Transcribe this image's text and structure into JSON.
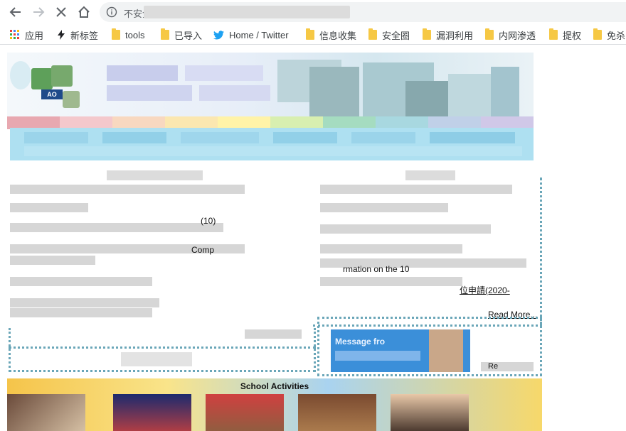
{
  "browser": {
    "security_label": "不安全",
    "bookmarks": [
      {
        "label": "应用",
        "icon": "apps-grid-icon"
      },
      {
        "label": "新标签",
        "icon": "lightning-icon"
      },
      {
        "label": "tools",
        "icon": "folder-icon"
      },
      {
        "label": "已导入",
        "icon": "folder-icon"
      },
      {
        "label": "Home / Twitter",
        "icon": "twitter-bird-icon"
      },
      {
        "label": "信息收集",
        "icon": "folder-icon"
      },
      {
        "label": "安全圈",
        "icon": "folder-icon"
      },
      {
        "label": "漏洞利用",
        "icon": "folder-icon"
      },
      {
        "label": "内网渗透",
        "icon": "folder-icon"
      },
      {
        "label": "提权",
        "icon": "folder-icon"
      },
      {
        "label": "免杀",
        "icon": "folder-icon"
      }
    ]
  },
  "page": {
    "banner_logo_text": "AO",
    "left_panel": {
      "fragments": [
        "(10)",
        "Comp"
      ]
    },
    "right_panel": {
      "fragments": [
        "rmation on the 10",
        "位申請(2020-"
      ],
      "read_more": "Read More..."
    },
    "message_box": {
      "title": "Message fro",
      "link_fragment": "Re"
    },
    "school_activities": {
      "title": "School Activities"
    }
  },
  "colors": {
    "toolbar_icon": "#5f6368",
    "dotted_border": "#6aa6b8",
    "nav_bar": "#aee0f1",
    "message_blue": "#3b8fd9",
    "twitter_blue": "#1da1f2",
    "folder_yellow": "#f6c844"
  }
}
